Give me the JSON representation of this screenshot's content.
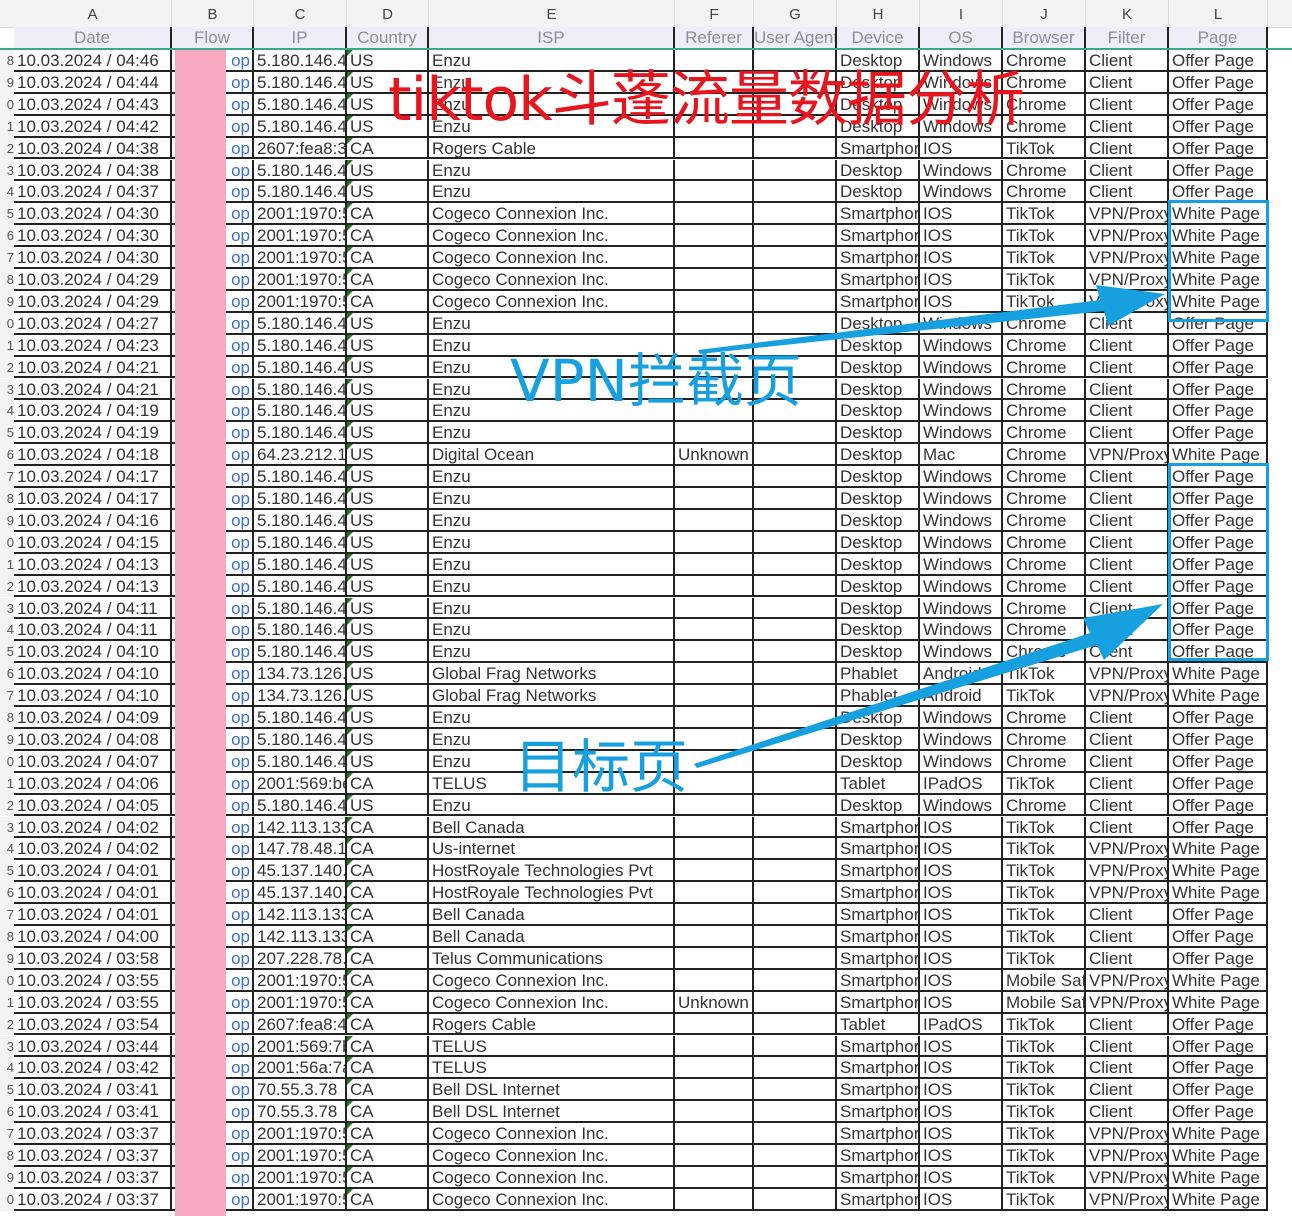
{
  "columns": [
    {
      "letter": "A",
      "field": "Date"
    },
    {
      "letter": "B",
      "field": "Flow"
    },
    {
      "letter": "C",
      "field": "IP"
    },
    {
      "letter": "D",
      "field": "Country"
    },
    {
      "letter": "E",
      "field": "ISP"
    },
    {
      "letter": "F",
      "field": "Referer"
    },
    {
      "letter": "G",
      "field": "User Agent"
    },
    {
      "letter": "H",
      "field": "Device"
    },
    {
      "letter": "I",
      "field": "OS"
    },
    {
      "letter": "J",
      "field": "Browser"
    },
    {
      "letter": "K",
      "field": "Filter"
    },
    {
      "letter": "L",
      "field": "Page"
    }
  ],
  "rows": [
    {
      "rn": "8",
      "date": "10.03.2024 / 04:46",
      "flow": "op",
      "ip": "5.180.146.4",
      "country": "US",
      "isp": "Enzu",
      "referer": "",
      "ua": "",
      "device": "Desktop",
      "os": "Windows",
      "browser": "Chrome",
      "filter": "Client",
      "page": "Offer Page"
    },
    {
      "rn": "9",
      "date": "10.03.2024 / 04:44",
      "flow": "op",
      "ip": "5.180.146.4",
      "country": "US",
      "isp": "Enzu",
      "referer": "",
      "ua": "",
      "device": "Desktop",
      "os": "Windows",
      "browser": "Chrome",
      "filter": "Client",
      "page": "Offer Page"
    },
    {
      "rn": "0",
      "date": "10.03.2024 / 04:43",
      "flow": "op",
      "ip": "5.180.146.4",
      "country": "US",
      "isp": "Enzu",
      "referer": "",
      "ua": "",
      "device": "Desktop",
      "os": "Windows",
      "browser": "Chrome",
      "filter": "Client",
      "page": "Offer Page"
    },
    {
      "rn": "1",
      "date": "10.03.2024 / 04:42",
      "flow": "op",
      "ip": "5.180.146.4",
      "country": "US",
      "isp": "Enzu",
      "referer": "",
      "ua": "",
      "device": "Desktop",
      "os": "Windows",
      "browser": "Chrome",
      "filter": "Client",
      "page": "Offer Page"
    },
    {
      "rn": "2",
      "date": "10.03.2024 / 04:38",
      "flow": "op",
      "ip": "2607:fea8:3",
      "country": "CA",
      "isp": "Rogers Cable",
      "referer": "",
      "ua": "",
      "device": "Smartphor",
      "os": "IOS",
      "browser": "TikTok",
      "filter": "Client",
      "page": "Offer Page"
    },
    {
      "rn": "3",
      "date": "10.03.2024 / 04:38",
      "flow": "op",
      "ip": "5.180.146.4",
      "country": "US",
      "isp": "Enzu",
      "referer": "",
      "ua": "",
      "device": "Desktop",
      "os": "Windows",
      "browser": "Chrome",
      "filter": "Client",
      "page": "Offer Page"
    },
    {
      "rn": "4",
      "date": "10.03.2024 / 04:37",
      "flow": "op",
      "ip": "5.180.146.4",
      "country": "US",
      "isp": "Enzu",
      "referer": "",
      "ua": "",
      "device": "Desktop",
      "os": "Windows",
      "browser": "Chrome",
      "filter": "Client",
      "page": "Offer Page"
    },
    {
      "rn": "5",
      "date": "10.03.2024 / 04:30",
      "flow": "op",
      "ip": "2001:1970:5",
      "country": "CA",
      "isp": "Cogeco Connexion Inc.",
      "referer": "",
      "ua": "",
      "device": "Smartphor",
      "os": "IOS",
      "browser": "TikTok",
      "filter": "VPN/Proxy",
      "page": "White Page"
    },
    {
      "rn": "6",
      "date": "10.03.2024 / 04:30",
      "flow": "op",
      "ip": "2001:1970:5",
      "country": "CA",
      "isp": "Cogeco Connexion Inc.",
      "referer": "",
      "ua": "",
      "device": "Smartphor",
      "os": "IOS",
      "browser": "TikTok",
      "filter": "VPN/Proxy",
      "page": "White Page"
    },
    {
      "rn": "7",
      "date": "10.03.2024 / 04:30",
      "flow": "op",
      "ip": "2001:1970:5",
      "country": "CA",
      "isp": "Cogeco Connexion Inc.",
      "referer": "",
      "ua": "",
      "device": "Smartphor",
      "os": "IOS",
      "browser": "TikTok",
      "filter": "VPN/Proxy",
      "page": "White Page"
    },
    {
      "rn": "8",
      "date": "10.03.2024 / 04:29",
      "flow": "op",
      "ip": "2001:1970:5",
      "country": "CA",
      "isp": "Cogeco Connexion Inc.",
      "referer": "",
      "ua": "",
      "device": "Smartphor",
      "os": "IOS",
      "browser": "TikTok",
      "filter": "VPN/Proxy",
      "page": "White Page"
    },
    {
      "rn": "9",
      "date": "10.03.2024 / 04:29",
      "flow": "op",
      "ip": "2001:1970:5",
      "country": "CA",
      "isp": "Cogeco Connexion Inc.",
      "referer": "",
      "ua": "",
      "device": "Smartphor",
      "os": "IOS",
      "browser": "TikTok",
      "filter": "VPN/Proxy",
      "page": "White Page"
    },
    {
      "rn": "0",
      "date": "10.03.2024 / 04:27",
      "flow": "op",
      "ip": "5.180.146.4",
      "country": "US",
      "isp": "Enzu",
      "referer": "",
      "ua": "",
      "device": "Desktop",
      "os": "Windows",
      "browser": "Chrome",
      "filter": "Client",
      "page": "Offer Page"
    },
    {
      "rn": "1",
      "date": "10.03.2024 / 04:23",
      "flow": "op",
      "ip": "5.180.146.4",
      "country": "US",
      "isp": "Enzu",
      "referer": "",
      "ua": "",
      "device": "Desktop",
      "os": "Windows",
      "browser": "Chrome",
      "filter": "Client",
      "page": "Offer Page"
    },
    {
      "rn": "2",
      "date": "10.03.2024 / 04:21",
      "flow": "op",
      "ip": "5.180.146.4",
      "country": "US",
      "isp": "Enzu",
      "referer": "",
      "ua": "",
      "device": "Desktop",
      "os": "Windows",
      "browser": "Chrome",
      "filter": "Client",
      "page": "Offer Page"
    },
    {
      "rn": "3",
      "date": "10.03.2024 / 04:21",
      "flow": "op",
      "ip": "5.180.146.4",
      "country": "US",
      "isp": "Enzu",
      "referer": "",
      "ua": "",
      "device": "Desktop",
      "os": "Windows",
      "browser": "Chrome",
      "filter": "Client",
      "page": "Offer Page"
    },
    {
      "rn": "4",
      "date": "10.03.2024 / 04:19",
      "flow": "op",
      "ip": "5.180.146.4",
      "country": "US",
      "isp": "Enzu",
      "referer": "",
      "ua": "",
      "device": "Desktop",
      "os": "Windows",
      "browser": "Chrome",
      "filter": "Client",
      "page": "Offer Page"
    },
    {
      "rn": "5",
      "date": "10.03.2024 / 04:19",
      "flow": "op",
      "ip": "5.180.146.4",
      "country": "US",
      "isp": "Enzu",
      "referer": "",
      "ua": "",
      "device": "Desktop",
      "os": "Windows",
      "browser": "Chrome",
      "filter": "Client",
      "page": "Offer Page"
    },
    {
      "rn": "6",
      "date": "10.03.2024 / 04:18",
      "flow": "op",
      "ip": "64.23.212.1",
      "country": "US",
      "isp": "Digital Ocean",
      "referer": "Unknown",
      "ua": "",
      "device": "Desktop",
      "os": "Mac",
      "browser": "Chrome",
      "filter": "VPN/Proxy",
      "page": "White Page"
    },
    {
      "rn": "7",
      "date": "10.03.2024 / 04:17",
      "flow": "op",
      "ip": "5.180.146.4",
      "country": "US",
      "isp": "Enzu",
      "referer": "",
      "ua": "",
      "device": "Desktop",
      "os": "Windows",
      "browser": "Chrome",
      "filter": "Client",
      "page": "Offer Page"
    },
    {
      "rn": "8",
      "date": "10.03.2024 / 04:17",
      "flow": "op",
      "ip": "5.180.146.4",
      "country": "US",
      "isp": "Enzu",
      "referer": "",
      "ua": "",
      "device": "Desktop",
      "os": "Windows",
      "browser": "Chrome",
      "filter": "Client",
      "page": "Offer Page"
    },
    {
      "rn": "9",
      "date": "10.03.2024 / 04:16",
      "flow": "op",
      "ip": "5.180.146.4",
      "country": "US",
      "isp": "Enzu",
      "referer": "",
      "ua": "",
      "device": "Desktop",
      "os": "Windows",
      "browser": "Chrome",
      "filter": "Client",
      "page": "Offer Page"
    },
    {
      "rn": "0",
      "date": "10.03.2024 / 04:15",
      "flow": "op",
      "ip": "5.180.146.4",
      "country": "US",
      "isp": "Enzu",
      "referer": "",
      "ua": "",
      "device": "Desktop",
      "os": "Windows",
      "browser": "Chrome",
      "filter": "Client",
      "page": "Offer Page"
    },
    {
      "rn": "1",
      "date": "10.03.2024 / 04:13",
      "flow": "op",
      "ip": "5.180.146.4",
      "country": "US",
      "isp": "Enzu",
      "referer": "",
      "ua": "",
      "device": "Desktop",
      "os": "Windows",
      "browser": "Chrome",
      "filter": "Client",
      "page": "Offer Page"
    },
    {
      "rn": "2",
      "date": "10.03.2024 / 04:13",
      "flow": "op",
      "ip": "5.180.146.4",
      "country": "US",
      "isp": "Enzu",
      "referer": "",
      "ua": "",
      "device": "Desktop",
      "os": "Windows",
      "browser": "Chrome",
      "filter": "Client",
      "page": "Offer Page"
    },
    {
      "rn": "3",
      "date": "10.03.2024 / 04:11",
      "flow": "op",
      "ip": "5.180.146.4",
      "country": "US",
      "isp": "Enzu",
      "referer": "",
      "ua": "",
      "device": "Desktop",
      "os": "Windows",
      "browser": "Chrome",
      "filter": "Client",
      "page": "Offer Page"
    },
    {
      "rn": "4",
      "date": "10.03.2024 / 04:11",
      "flow": "op",
      "ip": "5.180.146.4",
      "country": "US",
      "isp": "Enzu",
      "referer": "",
      "ua": "",
      "device": "Desktop",
      "os": "Windows",
      "browser": "Chrome",
      "filter": "Client",
      "page": "Offer Page"
    },
    {
      "rn": "5",
      "date": "10.03.2024 / 04:10",
      "flow": "op",
      "ip": "5.180.146.4",
      "country": "US",
      "isp": "Enzu",
      "referer": "",
      "ua": "",
      "device": "Desktop",
      "os": "Windows",
      "browser": "Chrome",
      "filter": "Client",
      "page": "Offer Page"
    },
    {
      "rn": "6",
      "date": "10.03.2024 / 04:10",
      "flow": "op",
      "ip": "134.73.126.",
      "country": "US",
      "isp": "Global Frag Networks",
      "referer": "",
      "ua": "",
      "device": "Phablet",
      "os": "Android",
      "browser": "TikTok",
      "filter": "VPN/Proxy",
      "page": "White Page"
    },
    {
      "rn": "7",
      "date": "10.03.2024 / 04:10",
      "flow": "op",
      "ip": "134.73.126.",
      "country": "US",
      "isp": "Global Frag Networks",
      "referer": "",
      "ua": "",
      "device": "Phablet",
      "os": "Android",
      "browser": "TikTok",
      "filter": "VPN/Proxy",
      "page": "White Page"
    },
    {
      "rn": "8",
      "date": "10.03.2024 / 04:09",
      "flow": "op",
      "ip": "5.180.146.4",
      "country": "US",
      "isp": "Enzu",
      "referer": "",
      "ua": "",
      "device": "Desktop",
      "os": "Windows",
      "browser": "Chrome",
      "filter": "Client",
      "page": "Offer Page"
    },
    {
      "rn": "9",
      "date": "10.03.2024 / 04:08",
      "flow": "op",
      "ip": "5.180.146.4",
      "country": "US",
      "isp": "Enzu",
      "referer": "",
      "ua": "",
      "device": "Desktop",
      "os": "Windows",
      "browser": "Chrome",
      "filter": "Client",
      "page": "Offer Page"
    },
    {
      "rn": "0",
      "date": "10.03.2024 / 04:07",
      "flow": "op",
      "ip": "5.180.146.4",
      "country": "US",
      "isp": "Enzu",
      "referer": "",
      "ua": "",
      "device": "Desktop",
      "os": "Windows",
      "browser": "Chrome",
      "filter": "Client",
      "page": "Offer Page"
    },
    {
      "rn": "1",
      "date": "10.03.2024 / 04:06",
      "flow": "op",
      "ip": "2001:569:be",
      "country": "CA",
      "isp": "TELUS",
      "referer": "",
      "ua": "",
      "device": "Tablet",
      "os": "IPadOS",
      "browser": "TikTok",
      "filter": "Client",
      "page": "Offer Page"
    },
    {
      "rn": "2",
      "date": "10.03.2024 / 04:05",
      "flow": "op",
      "ip": "5.180.146.4",
      "country": "US",
      "isp": "Enzu",
      "referer": "",
      "ua": "",
      "device": "Desktop",
      "os": "Windows",
      "browser": "Chrome",
      "filter": "Client",
      "page": "Offer Page"
    },
    {
      "rn": "3",
      "date": "10.03.2024 / 04:02",
      "flow": "op",
      "ip": "142.113.133",
      "country": "CA",
      "isp": "Bell Canada",
      "referer": "",
      "ua": "",
      "device": "Smartphor",
      "os": "IOS",
      "browser": "TikTok",
      "filter": "Client",
      "page": "Offer Page"
    },
    {
      "rn": "4",
      "date": "10.03.2024 / 04:02",
      "flow": "op",
      "ip": "147.78.48.1",
      "country": "CA",
      "isp": "Us-internet",
      "referer": "",
      "ua": "",
      "device": "Smartphor",
      "os": "IOS",
      "browser": "TikTok",
      "filter": "VPN/Proxy",
      "page": "White Page"
    },
    {
      "rn": "5",
      "date": "10.03.2024 / 04:01",
      "flow": "op",
      "ip": "45.137.140.",
      "country": "CA",
      "isp": "HostRoyale Technologies Pvt",
      "referer": "",
      "ua": "",
      "device": "Smartphor",
      "os": "IOS",
      "browser": "TikTok",
      "filter": "VPN/Proxy",
      "page": "White Page"
    },
    {
      "rn": "6",
      "date": "10.03.2024 / 04:01",
      "flow": "op",
      "ip": "45.137.140.",
      "country": "CA",
      "isp": "HostRoyale Technologies Pvt",
      "referer": "",
      "ua": "",
      "device": "Smartphor",
      "os": "IOS",
      "browser": "TikTok",
      "filter": "VPN/Proxy",
      "page": "White Page"
    },
    {
      "rn": "7",
      "date": "10.03.2024 / 04:01",
      "flow": "op",
      "ip": "142.113.133",
      "country": "CA",
      "isp": "Bell Canada",
      "referer": "",
      "ua": "",
      "device": "Smartphor",
      "os": "IOS",
      "browser": "TikTok",
      "filter": "Client",
      "page": "Offer Page"
    },
    {
      "rn": "8",
      "date": "10.03.2024 / 04:00",
      "flow": "op",
      "ip": "142.113.133",
      "country": "CA",
      "isp": "Bell Canada",
      "referer": "",
      "ua": "",
      "device": "Smartphor",
      "os": "IOS",
      "browser": "TikTok",
      "filter": "Client",
      "page": "Offer Page"
    },
    {
      "rn": "9",
      "date": "10.03.2024 / 03:58",
      "flow": "op",
      "ip": "207.228.78.",
      "country": "CA",
      "isp": "Telus Communications",
      "referer": "",
      "ua": "",
      "device": "Smartphor",
      "os": "IOS",
      "browser": "TikTok",
      "filter": "Client",
      "page": "Offer Page"
    },
    {
      "rn": "0",
      "date": "10.03.2024 / 03:55",
      "flow": "op",
      "ip": "2001:1970:5",
      "country": "CA",
      "isp": "Cogeco Connexion Inc.",
      "referer": "",
      "ua": "",
      "device": "Smartphor",
      "os": "IOS",
      "browser": "Mobile Safa",
      "filter": "VPN/Proxy",
      "page": "White Page"
    },
    {
      "rn": "1",
      "date": "10.03.2024 / 03:55",
      "flow": "op",
      "ip": "2001:1970:5",
      "country": "CA",
      "isp": "Cogeco Connexion Inc.",
      "referer": "Unknown",
      "ua": "",
      "device": "Smartphor",
      "os": "IOS",
      "browser": "Mobile Safa",
      "filter": "VPN/Proxy",
      "page": "White Page"
    },
    {
      "rn": "2",
      "date": "10.03.2024 / 03:54",
      "flow": "op",
      "ip": "2607:fea8:4",
      "country": "CA",
      "isp": "Rogers Cable",
      "referer": "",
      "ua": "",
      "device": "Tablet",
      "os": "IPadOS",
      "browser": "TikTok",
      "filter": "Client",
      "page": "Offer Page"
    },
    {
      "rn": "3",
      "date": "10.03.2024 / 03:44",
      "flow": "op",
      "ip": "2001:569:7b",
      "country": "CA",
      "isp": "TELUS",
      "referer": "",
      "ua": "",
      "device": "Smartphor",
      "os": "IOS",
      "browser": "TikTok",
      "filter": "Client",
      "page": "Offer Page"
    },
    {
      "rn": "4",
      "date": "10.03.2024 / 03:42",
      "flow": "op",
      "ip": "2001:56a:7a",
      "country": "CA",
      "isp": "TELUS",
      "referer": "",
      "ua": "",
      "device": "Smartphor",
      "os": "IOS",
      "browser": "TikTok",
      "filter": "Client",
      "page": "Offer Page"
    },
    {
      "rn": "5",
      "date": "10.03.2024 / 03:41",
      "flow": "op",
      "ip": "70.55.3.78",
      "country": "CA",
      "isp": "Bell DSL Internet",
      "referer": "",
      "ua": "",
      "device": "Smartphor",
      "os": "IOS",
      "browser": "TikTok",
      "filter": "Client",
      "page": "Offer Page"
    },
    {
      "rn": "6",
      "date": "10.03.2024 / 03:41",
      "flow": "op",
      "ip": "70.55.3.78",
      "country": "CA",
      "isp": "Bell DSL Internet",
      "referer": "",
      "ua": "",
      "device": "Smartphor",
      "os": "IOS",
      "browser": "TikTok",
      "filter": "Client",
      "page": "Offer Page"
    },
    {
      "rn": "7",
      "date": "10.03.2024 / 03:37",
      "flow": "op",
      "ip": "2001:1970:5",
      "country": "CA",
      "isp": "Cogeco Connexion Inc.",
      "referer": "",
      "ua": "",
      "device": "Smartphor",
      "os": "IOS",
      "browser": "TikTok",
      "filter": "VPN/Proxy",
      "page": "White Page"
    },
    {
      "rn": "8",
      "date": "10.03.2024 / 03:37",
      "flow": "op",
      "ip": "2001:1970:5",
      "country": "CA",
      "isp": "Cogeco Connexion Inc.",
      "referer": "",
      "ua": "",
      "device": "Smartphor",
      "os": "IOS",
      "browser": "TikTok",
      "filter": "VPN/Proxy",
      "page": "White Page"
    },
    {
      "rn": "9",
      "date": "10.03.2024 / 03:37",
      "flow": "op",
      "ip": "2001:1970:5",
      "country": "CA",
      "isp": "Cogeco Connexion Inc.",
      "referer": "",
      "ua": "",
      "device": "Smartphor",
      "os": "IOS",
      "browser": "TikTok",
      "filter": "VPN/Proxy",
      "page": "White Page"
    },
    {
      "rn": "0",
      "date": "10.03.2024 / 03:37",
      "flow": "op",
      "ip": "2001:1970:5",
      "country": "CA",
      "isp": "Cogeco Connexion Inc.",
      "referer": "",
      "ua": "",
      "device": "Smartphor",
      "os": "IOS",
      "browser": "TikTok",
      "filter": "VPN/Proxy",
      "page": "White Page"
    }
  ],
  "annotations": {
    "title": "tiktok斗蓬流量数据分析",
    "vpn_label": "VPN拦截页",
    "target_label": "目标页",
    "title_color": "#e8141e",
    "accent_color": "#16a0e0"
  }
}
